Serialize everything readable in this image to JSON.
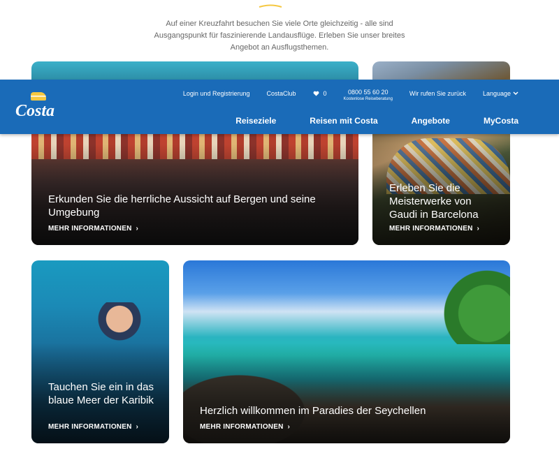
{
  "intro": {
    "lines": [
      "Auf einer Kreuzfahrt besuchen Sie viele Orte gleichzeitig - alle sind",
      "Ausgangspunkt für faszinierende Landausflüge. Erleben Sie unser breites",
      "Angebot an Ausflugsthemen."
    ]
  },
  "header": {
    "logo_text": "Costa",
    "top_links": {
      "login": "Login und Registrierung",
      "club": "CostaClub",
      "favorites_count": "0",
      "phone": "0800 55 60 20",
      "phone_sub": "Kostenlose Reiseberatung",
      "callback": "Wir rufen Sie zurück",
      "language": "Language"
    },
    "nav": [
      "Reiseziele",
      "Reisen mit Costa",
      "Angebote",
      "MyCosta"
    ]
  },
  "cards": [
    {
      "title": "Erkunden Sie die herrliche Aussicht auf Bergen und seine Umgebung",
      "cta": "MEHR INFORMATIONEN"
    },
    {
      "title": "Erleben Sie die Meisterwerke von Gaudi in Barcelona",
      "cta": "MEHR INFORMATIONEN"
    },
    {
      "title": "Tauchen Sie ein in das blaue Meer der Karibik",
      "cta": "MEHR INFORMATIONEN"
    },
    {
      "title": "Herzlich willkommen im Paradies der Seychellen",
      "cta": "MEHR INFORMATIONEN"
    }
  ],
  "colors": {
    "header_blue": "#1a6bb8",
    "accent_yellow": "#f5c842"
  },
  "icons": {
    "chevron": "chevron-right-icon",
    "heart": "heart-icon",
    "language_chevron": "chevron-down-icon"
  }
}
